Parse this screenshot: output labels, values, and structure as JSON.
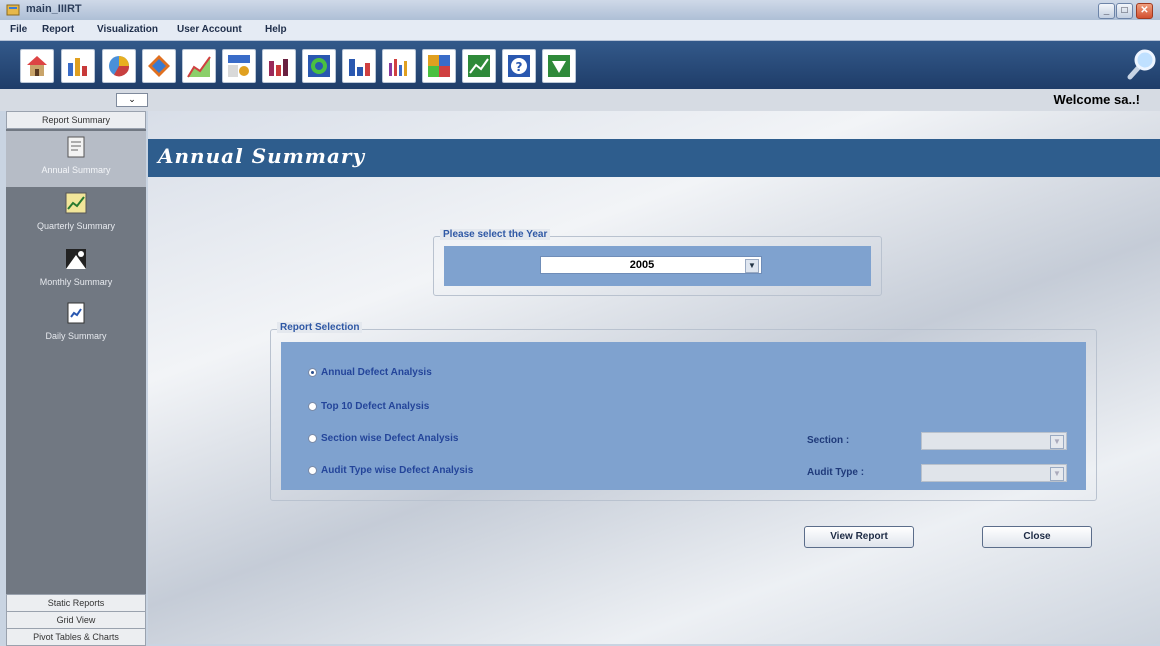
{
  "window": {
    "title": "main_IIIRT",
    "minimize": "_",
    "restore": "□",
    "close": "✕"
  },
  "menu": [
    "File",
    "Report",
    "Visualization",
    "User Account",
    "Help"
  ],
  "toolbar": {
    "icons": [
      "home-icon",
      "bar-chart-icon",
      "pie-chart-icon",
      "3d-chart-icon",
      "area-chart-icon",
      "table-chart-icon",
      "column-chart-icon",
      "donut-chart-icon",
      "histogram-icon",
      "multi-bar-icon",
      "map-icon",
      "line-chart-icon",
      "help-icon",
      "exit-icon"
    ]
  },
  "subbar": {
    "collapse_label": "⌄",
    "welcome": "Welcome  sa..!"
  },
  "sidebar": {
    "top_header": "Report Summary",
    "items": [
      {
        "label": "Annual Summary",
        "icon": "annual-report-icon",
        "active": true
      },
      {
        "label": "Quarterly Summary",
        "icon": "quarterly-report-icon",
        "active": false
      },
      {
        "label": "Monthly Summary",
        "icon": "monthly-report-icon",
        "active": false
      },
      {
        "label": "Daily Summary",
        "icon": "daily-report-icon",
        "active": false
      }
    ],
    "bottom_headers": [
      "Static Reports",
      "Grid View",
      "Pivot Tables & Charts"
    ]
  },
  "main": {
    "title": "Annual Summary",
    "year_group": {
      "legend": "Please select the Year",
      "selected": "2005"
    },
    "report_group": {
      "legend": "Report Selection",
      "options": [
        {
          "label": "Annual Defect Analysis",
          "checked": true
        },
        {
          "label": "Top 10 Defect Analysis",
          "checked": false
        },
        {
          "label": "Section wise Defect Analysis",
          "checked": false
        },
        {
          "label": "Audit Type wise Defect Analysis",
          "checked": false
        }
      ],
      "section_label": "Section :",
      "section_value": "",
      "audit_type_label": "Audit Type :",
      "audit_type_value": ""
    },
    "buttons": {
      "view_report": "View Report",
      "close": "Close"
    }
  },
  "colors": {
    "header_blue": "#2e5d8d",
    "panel_blue": "#7fa2cf",
    "label_blue": "#2f58a5",
    "sidebar_gray": "#717882"
  }
}
